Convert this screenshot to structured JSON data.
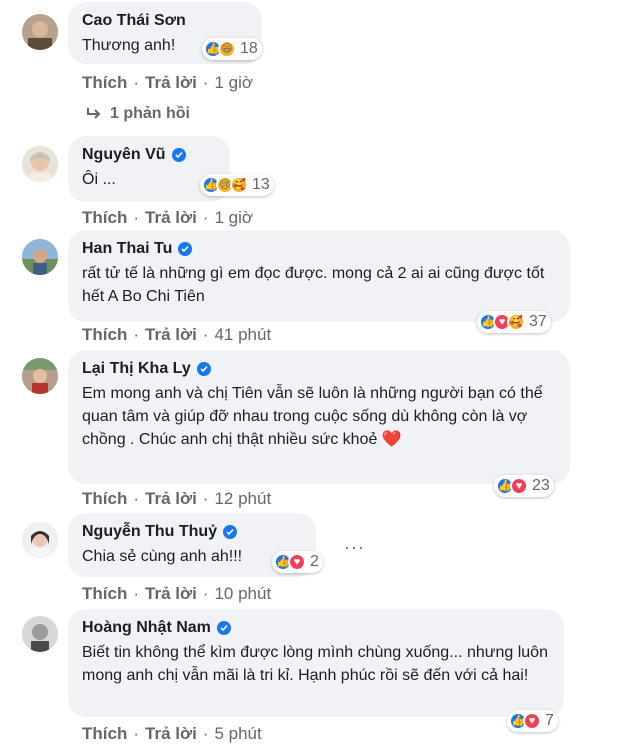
{
  "actions": {
    "like": "Thích",
    "reply": "Trả lời",
    "separator": "·"
  },
  "comments": [
    {
      "name": "Cao Thái Sơn",
      "verified": false,
      "text": "Thương anh!",
      "reaction_count": "18",
      "reactions": [
        "like",
        "haha"
      ],
      "time": "1 giờ",
      "replies_label": "1 phản hồi"
    },
    {
      "name": "Nguyên Vũ",
      "verified": true,
      "text": "Ôi ...",
      "reaction_count": "13",
      "reactions": [
        "like",
        "sad",
        "care"
      ],
      "time": "1 giờ"
    },
    {
      "name": "Han Thai Tu",
      "verified": true,
      "text": "rất tử tế là những gì em đọc được. mong cả 2 ai ai cũng được tốt hết A Bo Chi Tiên",
      "reaction_count": "37",
      "reactions": [
        "like",
        "love",
        "care"
      ],
      "time": "41 phút"
    },
    {
      "name": "Lại Thị Kha Ly",
      "verified": true,
      "text": "Em mong anh và chị Tiên vẫn sẽ luôn là những người bạn có thể quan tâm và giúp đỡ nhau trong cuộc sống dù không còn là vợ chồng . Chúc anh chị thật nhiều sức khoẻ",
      "text_emoji": "❤️",
      "reaction_count": "23",
      "reactions": [
        "like",
        "love"
      ],
      "time": "12 phút"
    },
    {
      "name": "Nguyễn Thu Thuỷ",
      "verified": true,
      "text": "Chia sẻ cùng anh ah!!!",
      "reaction_count": "2",
      "reactions": [
        "like",
        "love"
      ],
      "time": "10 phút",
      "more": "···"
    },
    {
      "name": "Hoàng Nhật Nam",
      "verified": true,
      "text": "Biết tin không thể kìm được lòng mình chùng xuống... nhưng luôn mong anh chị vẫn mãi là tri kỉ. Hạnh phúc rồi sẽ đến với cả hai!",
      "reaction_count": "7",
      "reactions": [
        "like",
        "love"
      ],
      "time": "5 phút"
    }
  ],
  "colors": {
    "like": "#1877f2",
    "love": "#f33e58",
    "haha": "#f7b125",
    "bubble": "#f0f2f5",
    "meta": "#65676b"
  },
  "icons": {
    "verified": "verified-check-icon",
    "reply_arrow": "reply-arrow-icon",
    "more": "more-options-icon"
  }
}
